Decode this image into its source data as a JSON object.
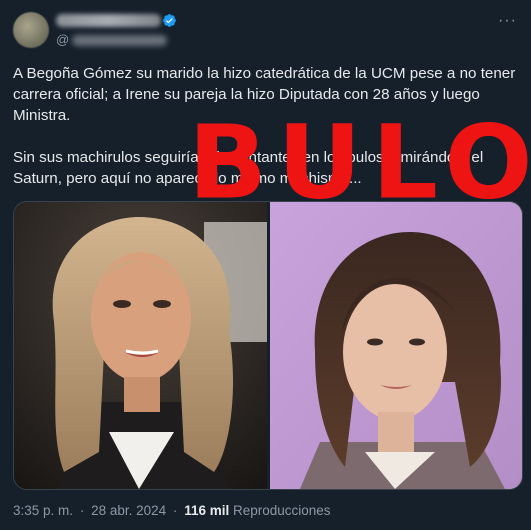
{
  "header": {
    "handle_prefix": "@",
    "more_label": "···"
  },
  "tweet": {
    "paragraph1": "A Begoña Gómez su marido la hizo catedrática de la UCM pese a no tener carrera oficial; a Irene su pareja la hizo Diputada con 28 años y luego Ministra.",
    "paragraph2": "Sin sus machirulos seguirían de cantantes en los bulos o mirándole el Saturn, pero aquí no aparece lo mismo machismo..."
  },
  "stamp": {
    "text": "BULO",
    "color": "#ee1414"
  },
  "footer": {
    "time": "3:35 p. m.",
    "separator": "·",
    "date": "28 abr. 2024",
    "views_count": "116 mil",
    "views_label": "Reproducciones"
  },
  "colors": {
    "background": "#15202b",
    "text": "#e7e9ea",
    "muted": "#8b98a5",
    "verified": "#1d9bf0"
  },
  "icons": {
    "verified": "verified-badge-icon",
    "more": "more-options-icon"
  }
}
